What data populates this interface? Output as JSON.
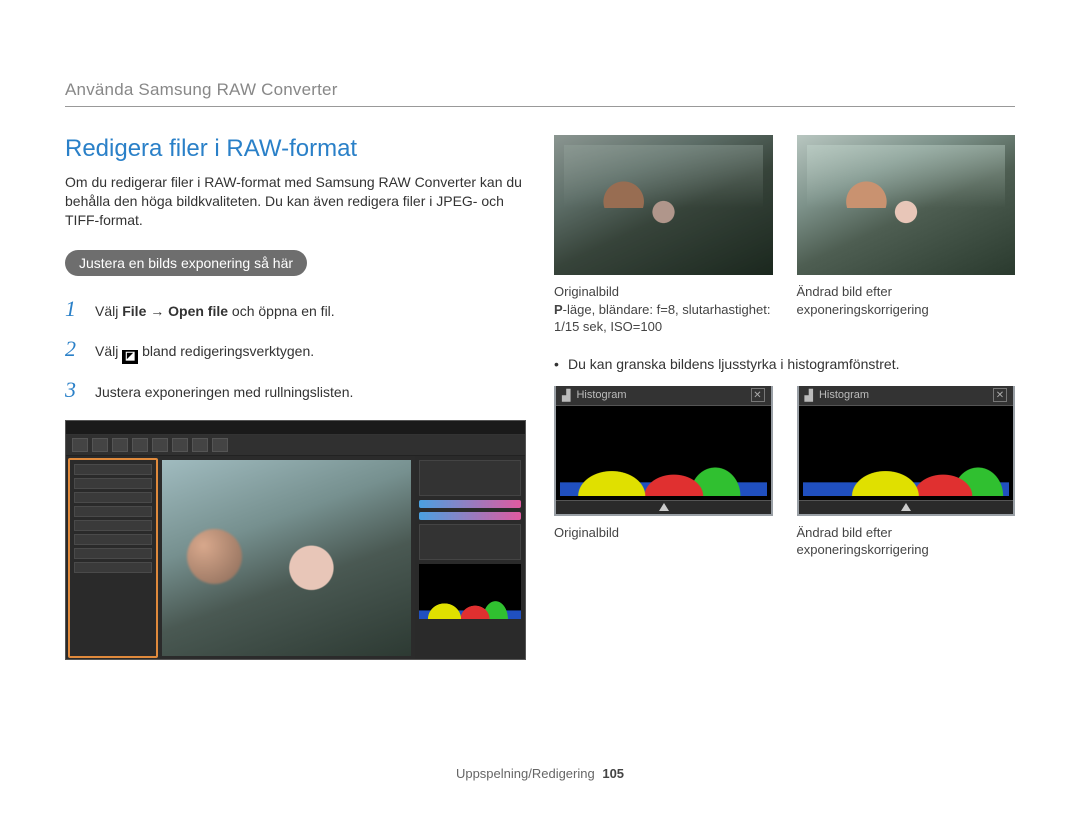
{
  "header": {
    "breadcrumb": "Använda Samsung RAW Converter"
  },
  "left": {
    "title": "Redigera filer i RAW-format",
    "intro": "Om du redigerar filer i RAW-format med Samsung RAW Converter kan du behålla den höga bildkvaliteten. Du kan även redigera filer i JPEG- och TIFF-format.",
    "pill": "Justera en bilds exponering så här",
    "steps": {
      "s1_prefix": "Välj ",
      "s1_bold1": "File",
      "s1_arrow": " → ",
      "s1_bold2": "Open file",
      "s1_suffix": " och öppna en fil.",
      "s2_prefix": "Välj ",
      "s2_icon_glyph": "◪",
      "s2_suffix": " bland redigeringsverktygen.",
      "s3": "Justera exponeringen med rullningslisten."
    }
  },
  "right": {
    "caption1_left_line1": "Originalbild",
    "caption1_left_line2_prefix": "P",
    "caption1_left_line2_rest": "-läge, bländare: f=8, slutarhastighet: 1/15 sek, ISO=100",
    "caption1_right": "Ändrad bild efter exponeringskorrigering",
    "bullet": "Du kan granska bildens ljusstyrka i histogramfönstret.",
    "hist_label": "Histogram",
    "caption2_left": "Originalbild",
    "caption2_right": "Ändrad bild efter exponeringskorrigering"
  },
  "footer": {
    "section": "Uppspelning/Redigering",
    "page": "105"
  }
}
